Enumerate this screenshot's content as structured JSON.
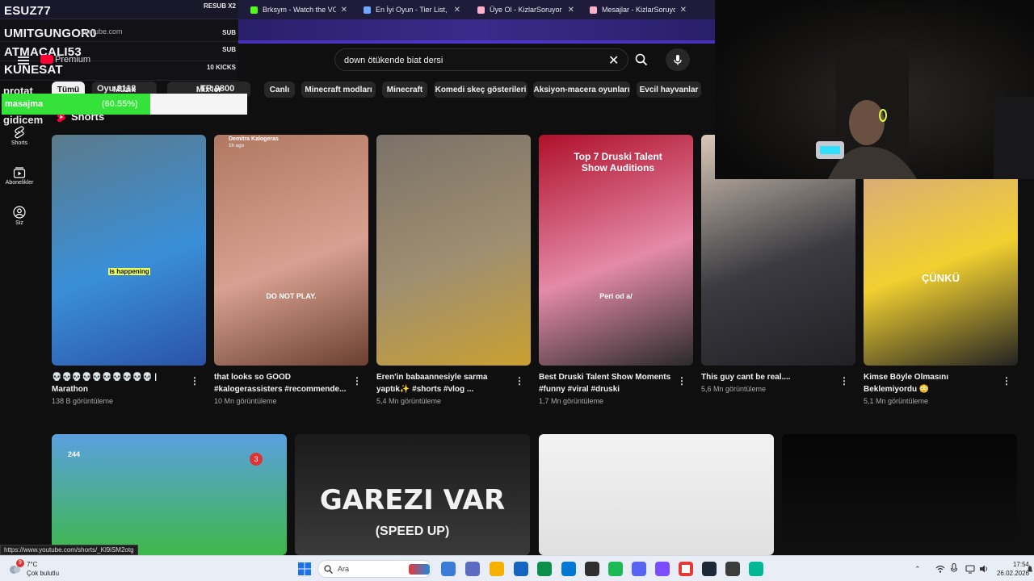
{
  "browser": {
    "tabs": [
      {
        "title": "Brksym - Watch the VOD",
        "fav_color": "#53fc18"
      },
      {
        "title": "En İyi Oyun - Tier List, Kö",
        "fav_color": "#6fa8ff"
      },
      {
        "title": "Üye Ol - KizlarSoruyor",
        "fav_color": "#ffb0c8"
      },
      {
        "title": "Mesajlar - KizlarSoruyor",
        "fav_color": "#ffb0c8"
      }
    ]
  },
  "chat": {
    "rows": [
      {
        "name": "ESUZ77",
        "right": "RESUB X2"
      },
      {
        "name": "UMITGUNGOR0",
        "right": "SUB"
      },
      {
        "name": "ATMACALI53",
        "right": "SUB"
      },
      {
        "name": "KUNESAT",
        "right": "10 KICKS"
      }
    ],
    "yt_domain": "youtube.com",
    "premium": "Premium",
    "progress": {
      "label": "masajma",
      "percent_text": "(60.55%)",
      "value": 0.6055
    },
    "overlay": {
      "top": "protat",
      "followers": "Oyu 2118 ",
      "second": "TR 9800 ",
      "bottom": "gidicem"
    }
  },
  "search": {
    "value": "down ötükende biat dersi"
  },
  "chips": [
    {
      "label": "Tümü",
      "active": true
    },
    {
      "label": "Müzik",
      "active": false
    },
    {
      "label": "Mix'ler",
      "active": false
    },
    {
      "label": "Canlı",
      "active": false
    },
    {
      "label": "Minecraft modları",
      "active": false
    },
    {
      "label": "Minecraft",
      "active": false
    },
    {
      "label": "Komedi skeç gösterileri",
      "active": false
    },
    {
      "label": "Aksiyon-macera oyunları",
      "active": false
    },
    {
      "label": "Evcil hayvanlar",
      "active": false
    }
  ],
  "nav": [
    {
      "label": "Shorts",
      "icon": "shorts-icon"
    },
    {
      "label": "Abonelikler",
      "icon": "subscriptions-icon"
    },
    {
      "label": "Siz",
      "icon": "you-icon"
    }
  ],
  "shorts_heading": "Shorts",
  "shorts": [
    {
      "title": "💀💀💀💀💀💀💀💀💀💀 | Marathon",
      "views": "138 B görüntüleme",
      "caption": "is happening",
      "colors": [
        "#5b7a8a",
        "#3a8fd8",
        "#2a52a8"
      ]
    },
    {
      "title": "that looks so GOOD #kalogerassisters #recommende...",
      "views": "10 Mn görüntüleme",
      "caption": "DO NOT PLAY.",
      "channel": "Demitra Kalogeras",
      "ago": "1h ago",
      "colors": [
        "#b07860",
        "#d8a090",
        "#6a4030"
      ]
    },
    {
      "title": "Eren'in babaannesiyle sarma yaptık✨ #shorts #vlog ...",
      "views": "5,4 Mn görüntüleme",
      "colors": [
        "#7a7168",
        "#a08f70",
        "#caa030"
      ]
    },
    {
      "title": "Best Druski Talent Show Moments #funny #viral #druski",
      "views": "1,7 Mn görüntüleme",
      "caption_title": "Top 7 Druski Talent Show Auditions",
      "caption": "Peri od a/",
      "colors": [
        "#b0102a",
        "#e48aa8",
        "#2a2a2a"
      ]
    },
    {
      "title": "This guy cant be real....",
      "views": "5,6 Mn görüntüleme",
      "colors": [
        "#d8c8b8",
        "#3a3a40",
        "#202025"
      ]
    },
    {
      "title": "Kimse Böyle Olmasını Beklemiyordu 😳",
      "views": "5,1 Mn görüntüleme",
      "caption": "ÇÜNKÜ",
      "colors": [
        "#d0a090",
        "#f2d030",
        "#222"
      ]
    }
  ],
  "videos": [
    {
      "title_text": "",
      "coin": "244",
      "badge": "3",
      "colors": [
        "#5aa0e0",
        "#3eb84a"
      ]
    },
    {
      "title_text": "GAREZI VAR",
      "subtitle": "(SPEED UP)",
      "colors": [
        "#1a1a1a",
        "#3a3a3a"
      ]
    },
    {
      "title_text": "",
      "colors": [
        "#f2f2f2",
        "#e0e0e0"
      ]
    },
    {
      "title_text": "",
      "colors": [
        "#050505",
        "#101010"
      ]
    }
  ],
  "status_link": "https://www.youtube.com/shorts/_Kl9iSM2otg",
  "taskbar": {
    "weather_temp": "7°C",
    "weather_desc": "Çok bulutlu",
    "notif_count": "9",
    "search_placeholder": "Ara",
    "time": "17:54",
    "date": "26.02.2026"
  }
}
